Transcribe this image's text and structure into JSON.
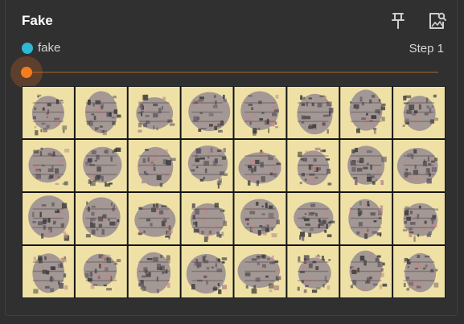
{
  "card": {
    "title": "Fake",
    "series_name": "fake",
    "series_color": "#2fb8d3",
    "step_text": "Step 1"
  },
  "toolbar": {
    "pin_icon": "pin-icon",
    "image_search_icon": "image-search-icon"
  },
  "slider": {
    "value": 0,
    "accent": "#f57c1f"
  },
  "image": {
    "rows": 4,
    "cols": 8,
    "tile_background": "#efe1a6",
    "blob_color": "#3a3a3a"
  }
}
